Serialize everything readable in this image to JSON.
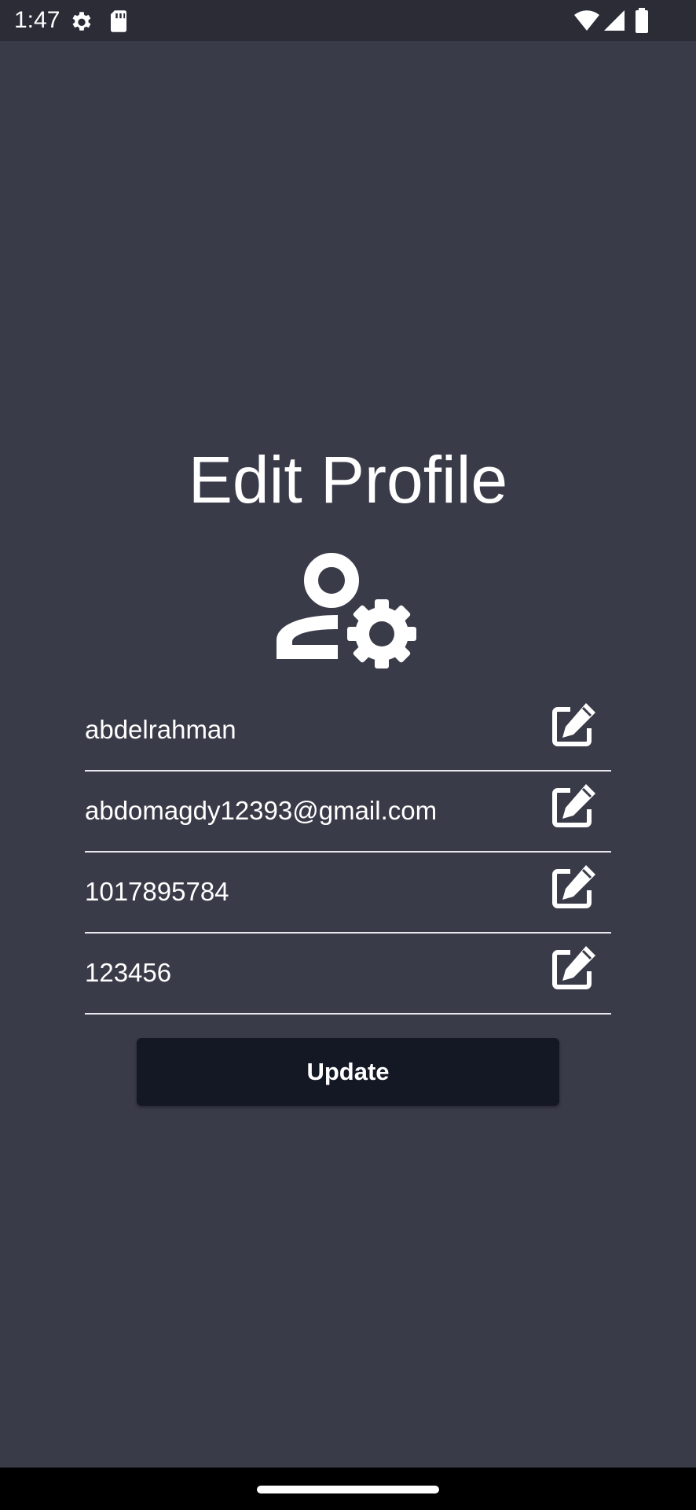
{
  "status_bar": {
    "time": "1:47",
    "icons": [
      "gear-icon",
      "sd-card-icon",
      "wifi-icon",
      "signal-icon",
      "battery-icon"
    ]
  },
  "page": {
    "title": "Edit Profile",
    "header_icon": "manage-account-icon"
  },
  "fields": [
    {
      "name": "username",
      "value": "abdelrahman",
      "icon": "edit-icon"
    },
    {
      "name": "email",
      "value": "abdomagdy12393@gmail.com",
      "icon": "edit-icon"
    },
    {
      "name": "phone",
      "value": "1017895784",
      "icon": "edit-icon"
    },
    {
      "name": "password",
      "value": "123456",
      "icon": "edit-icon"
    }
  ],
  "actions": {
    "update_label": "Update"
  },
  "colors": {
    "background": "#3a3b48",
    "status_bar": "#2b2c36",
    "button": "#141724",
    "text": "#ffffff"
  }
}
